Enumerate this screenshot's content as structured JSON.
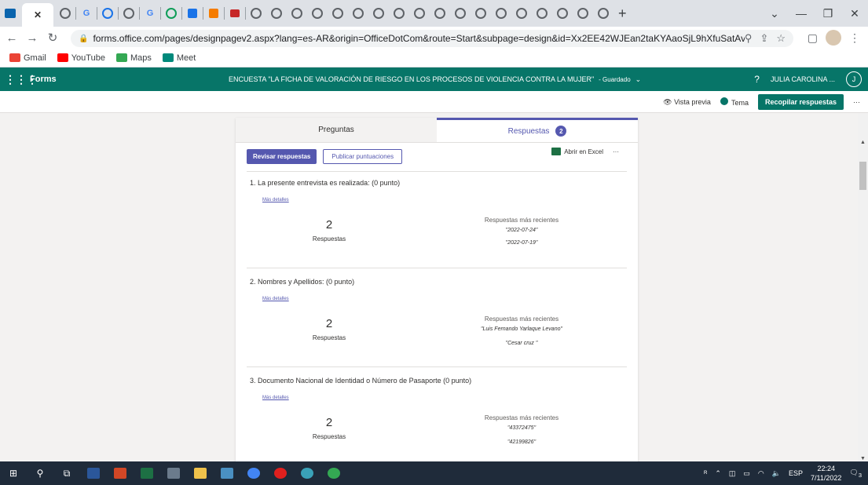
{
  "browser": {
    "url": "forms.office.com/pages/designpagev2.aspx?lang=es-AR&origin=OfficeDotCom&route=Start&subpage=design&id=Xx2EE42WJEan2taKYAaoSjL9hXfuSatAvAfMW...",
    "bookmarks": [
      {
        "label": "Gmail",
        "color": "#ea4335"
      },
      {
        "label": "YouTube",
        "color": "#ff0000"
      },
      {
        "label": "Maps",
        "color": "#34a853"
      },
      {
        "label": "Meet",
        "color": "#00897b"
      }
    ],
    "tab_letters": [
      "G",
      "G"
    ]
  },
  "forms": {
    "app_name": "Forms",
    "title": "ENCUESTA \"LA FICHA DE VALORACIÓN DE RIESGO EN LOS PROCESOS DE VIOLENCIA CONTRA LA MUJER\"",
    "saved_status": "- Guardado",
    "help": "?",
    "user_name": "JULIA CAROLINA ...",
    "user_initial": "J",
    "preview_label": "Vista previa",
    "theme_label": "Tema",
    "collect_label": "Recopilar respuestas",
    "more": "···"
  },
  "tabs": {
    "questions": "Preguntas",
    "responses": "Respuestas",
    "responses_count": "2"
  },
  "actions": {
    "review": "Revisar respuestas",
    "publish": "Publicar puntuaciones",
    "excel": "Abrir en Excel",
    "more": "···"
  },
  "questions": [
    {
      "title": "1. La presente entrevista es realizada: (0 punto)",
      "more": "Más detalles",
      "count": "2",
      "count_label": "Respuestas",
      "recent_label": "Respuestas más recientes",
      "answers": [
        "\"2022-07-24\"",
        "\"2022-07-19\""
      ]
    },
    {
      "title": "2. Nombres y Apellidos: (0 punto)",
      "more": "Más detalles",
      "count": "2",
      "count_label": "Respuestas",
      "recent_label": "Respuestas más recientes",
      "answers": [
        "\"Luis Fernando Yarlaque Levano\"",
        "\"Cesar cruz \""
      ]
    },
    {
      "title": "3. Documento Nacional de Identidad o Número de Pasaporte (0 punto)",
      "more": "Más detalles",
      "count": "2",
      "count_label": "Respuestas",
      "recent_label": "Respuestas más recientes",
      "answers": [
        "\"43372475\"",
        "\"42199826\""
      ]
    }
  ],
  "taskbar": {
    "lang": "ESP",
    "time": "22:24",
    "date": "7/11/2022",
    "notifications": "3"
  }
}
